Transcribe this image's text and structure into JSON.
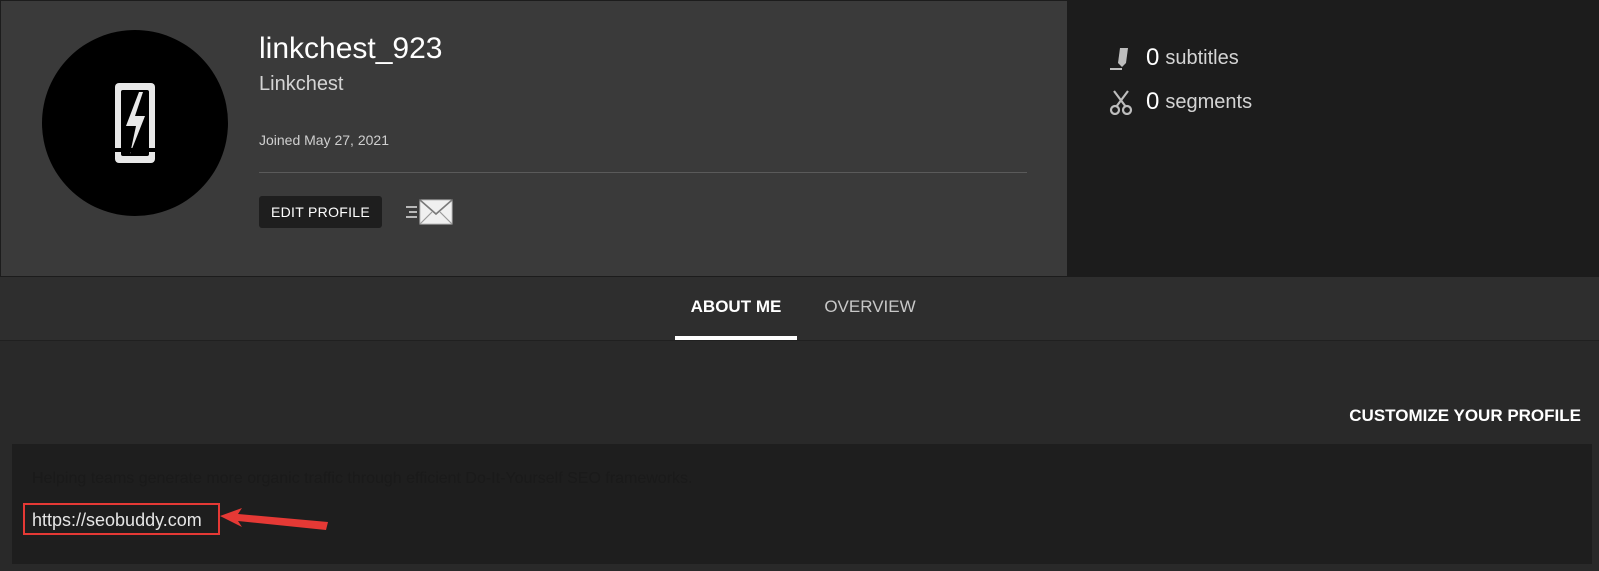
{
  "profile": {
    "username": "linkchest_923",
    "display_name": "Linkchest",
    "joined": "Joined May 27, 2021",
    "edit_label": "EDIT PROFILE",
    "avatar_icon": "lightning-logo-icon",
    "message_icon": "send-message-icon"
  },
  "stats": [
    {
      "count": "0",
      "label": "subtitles",
      "icon": "pencil-icon"
    },
    {
      "count": "0",
      "label": "segments",
      "icon": "scissors-icon"
    }
  ],
  "tabs": [
    {
      "label": "ABOUT ME",
      "active": true
    },
    {
      "label": "OVERVIEW",
      "active": false
    }
  ],
  "about": {
    "customize_label": "CUSTOMIZE YOUR PROFILE",
    "bio": "Helping teams generate more organic traffic through efficient Do-It-Yourself SEO frameworks.",
    "link": "https://seobuddy.com"
  },
  "colors": {
    "header_bg": "#3a3a3a",
    "stats_bg": "#1c1c1c",
    "page_bg": "#292929",
    "annotation": "#e53935"
  }
}
